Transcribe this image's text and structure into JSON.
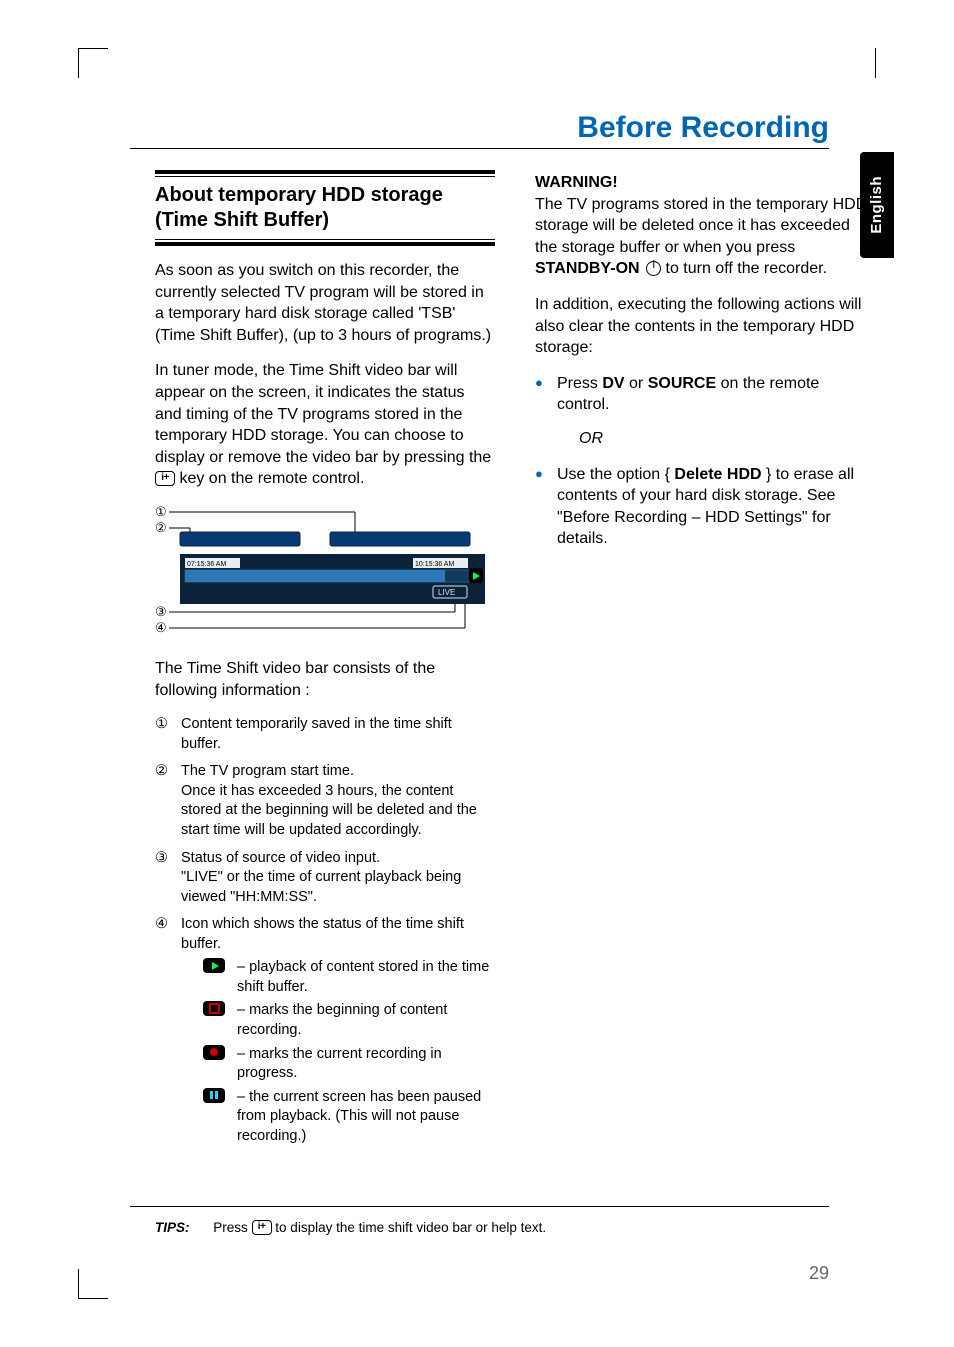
{
  "language_tab": "English",
  "page_title": "Before Recording",
  "page_number": "29",
  "left": {
    "heading": "About temporary HDD storage (Time Shift Buffer)",
    "p1": "As soon as you switch on this recorder, the currently selected TV program will be stored in a temporary hard disk storage called 'TSB' (Time Shift Buffer), (up to 3 hours of programs.)",
    "p2_a": "In tuner mode, the Time Shift video bar will appear on the screen, it indicates the status and timing of the TV programs stored in the temporary HDD storage. You can choose to display or remove the video bar by pressing the ",
    "p2_b": " key on the remote control.",
    "p3": "The Time Shift video bar consists of the following information :",
    "items": {
      "n1": "①",
      "t1": "Content temporarily saved in the time shift buffer.",
      "n2": "②",
      "t2": "The TV program start time.\nOnce it has exceeded 3 hours, the content stored at the beginning will be deleted and the start time will be updated accordingly.",
      "n3": "③",
      "t3": "Status of source of video input.\n\"LIVE\" or the time of current playback being viewed \"HH:MM:SS\".",
      "n4": "④",
      "t4": "Icon which shows the status of the time shift buffer."
    },
    "icons": {
      "play": "– playback of content stored in the time shift buffer.",
      "mark": "– marks the beginning of content recording.",
      "rec": "– marks the current recording in progress.",
      "pause": "– the current screen has been paused from playback. (This will not pause recording.)"
    },
    "diagram": {
      "label1": "①",
      "label2": "②",
      "label3": "③",
      "label4": "④",
      "time_left": "07:15:36 AM",
      "time_right": "10:15:36 AM",
      "live": "LIVE"
    }
  },
  "right": {
    "warning_label": "WARNING!",
    "warning_a": "The TV programs stored in the temporary HDD storage will be deleted once it has exceeded the storage buffer or when you press ",
    "warning_key": "STANDBY-ON",
    "warning_b": " to turn off the recorder.",
    "p2": "In addition, executing the following actions will also clear the contents in the temporary HDD storage:",
    "b1_a": "Press ",
    "b1_dv": "DV",
    "b1_or": " or ",
    "b1_src": "SOURCE",
    "b1_b": " on the remote control.",
    "or": "OR",
    "b2_a": "Use the option { ",
    "b2_key": "Delete HDD",
    "b2_b": " } to erase all contents of your hard disk storage. See \"Before Recording – HDD Settings\" for details."
  },
  "tips": {
    "label": "TIPS:",
    "text_a": "Press ",
    "text_b": " to display the time shift video bar or help text."
  }
}
